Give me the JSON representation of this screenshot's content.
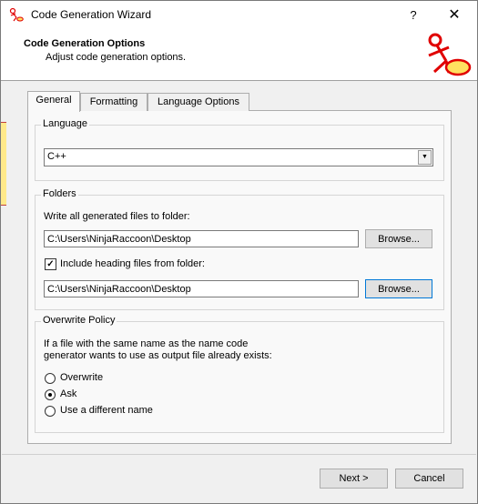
{
  "window": {
    "title": "Code Generation Wizard",
    "help_label": "?",
    "close_label": "✕"
  },
  "header": {
    "title": "Code Generation Options",
    "subtitle": "Adjust code generation options."
  },
  "tabs": [
    {
      "label": "General",
      "active": true
    },
    {
      "label": "Formatting",
      "active": false
    },
    {
      "label": "Language Options",
      "active": false
    }
  ],
  "language": {
    "group_label": "Language",
    "selected": "C++"
  },
  "folders": {
    "group_label": "Folders",
    "write_label": "Write all generated files to folder:",
    "write_path": "C:\\Users\\NinjaRaccoon\\Desktop",
    "browse_label": "Browse...",
    "include_heading_label": "Include heading files from folder:",
    "include_heading_checked": true,
    "heading_path": "C:\\Users\\NinjaRaccoon\\Desktop",
    "browse2_label": "Browse..."
  },
  "overwrite": {
    "group_label": "Overwrite Policy",
    "description_line1": "If a file with the same name as the name code",
    "description_line2": "generator wants to use as output file already exists:",
    "options": [
      {
        "label": "Overwrite",
        "checked": false
      },
      {
        "label": "Ask",
        "checked": true
      },
      {
        "label": "Use a different name",
        "checked": false
      }
    ]
  },
  "footer": {
    "next_label": "Next >",
    "cancel_label": "Cancel"
  },
  "colors": {
    "logo_red": "#e00000",
    "logo_yellow": "#ffe060",
    "focus_blue": "#0078d7"
  }
}
